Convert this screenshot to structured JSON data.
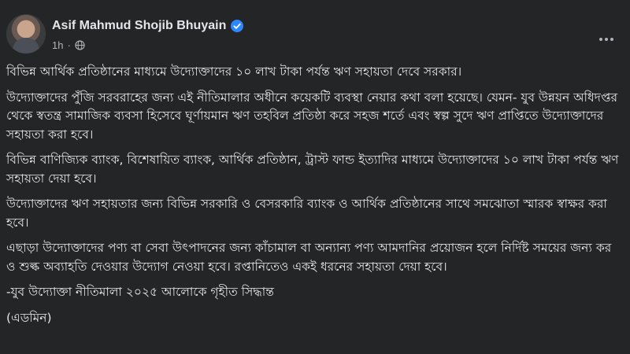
{
  "post": {
    "author": {
      "name": "Asif Mahmud Shojib Bhuyain",
      "verified": true,
      "avatar": "avatar-photo"
    },
    "timestamp": "1h",
    "visibility_icon": "globe-icon",
    "more_icon": "more-options-icon",
    "paragraphs": [
      "বিভিন্ন আর্থিক প্রতিষ্ঠানের মাধ্যমে উদ্যোক্তাদের ১০ লাখ টাকা পর্যন্ত ঋণ সহায়তা দেবে সরকার।",
      "উদ্যোক্তাদের পুঁজি সরবরাহের জন্য এই নীতিমালার অধীনে কয়েকটি ব্যবস্থা নেয়ার কথা বলা হয়েছে। যেমন- যুব উন্নয়ন অধিদপ্তর থেকে স্বতন্ত্র সামাজিক ব্যবসা হিসেবে ঘূর্ণায়মান ঋণ তহবিল প্রতিষ্ঠা করে সহজ শর্তে এবং স্বল্প সুদে ঋণ প্রাপ্তিতে উদ্যোক্তাদের সহায়তা করা হবে।",
      "বিভিন্ন বাণিজ্যিক ব্যাংক, বিশেষায়িত ব্যাংক, আর্থিক প্রতিষ্ঠান, ট্রাস্ট ফান্ড ইত্যাদির মাধ্যমে উদ্যোক্তাদের ১০ লাখ টাকা পর্যন্ত ঋণ সহায়তা দেয়া হবে।",
      "উদ্যোক্তাদের ঋণ সহায়তার জন্য বিভিন্ন সরকারি ও বেসরকারি ব্যাংক ও আর্থিক প্রতিষ্ঠানের সাথে সমঝোতা স্মারক স্বাক্ষর করা হবে।",
      "এছাড়া উদ্যোক্তাদের পণ্য বা সেবা উৎপাদনের জন্য কাঁচামাল বা অন্যান্য পণ্য আমদানির প্রয়োজন হলে নির্দিষ্ট সময়ের জন্য কর ও শুল্ক অব্যাহতি দেওয়ার উদ্যোগ নেওয়া হবে। রপ্তানিতেও একই ধরনের সহায়তা দেয়া হবে।",
      "-যুব উদ্যোক্তা নীতিমালা ২০২৫ আলোকে গৃহীত সিদ্ধান্ত",
      "(এডমিন)"
    ]
  },
  "colors": {
    "background": "#242526",
    "text": "#e4e6eb",
    "secondary_text": "#b0b3b8",
    "verified_badge": "#2d88ff"
  }
}
